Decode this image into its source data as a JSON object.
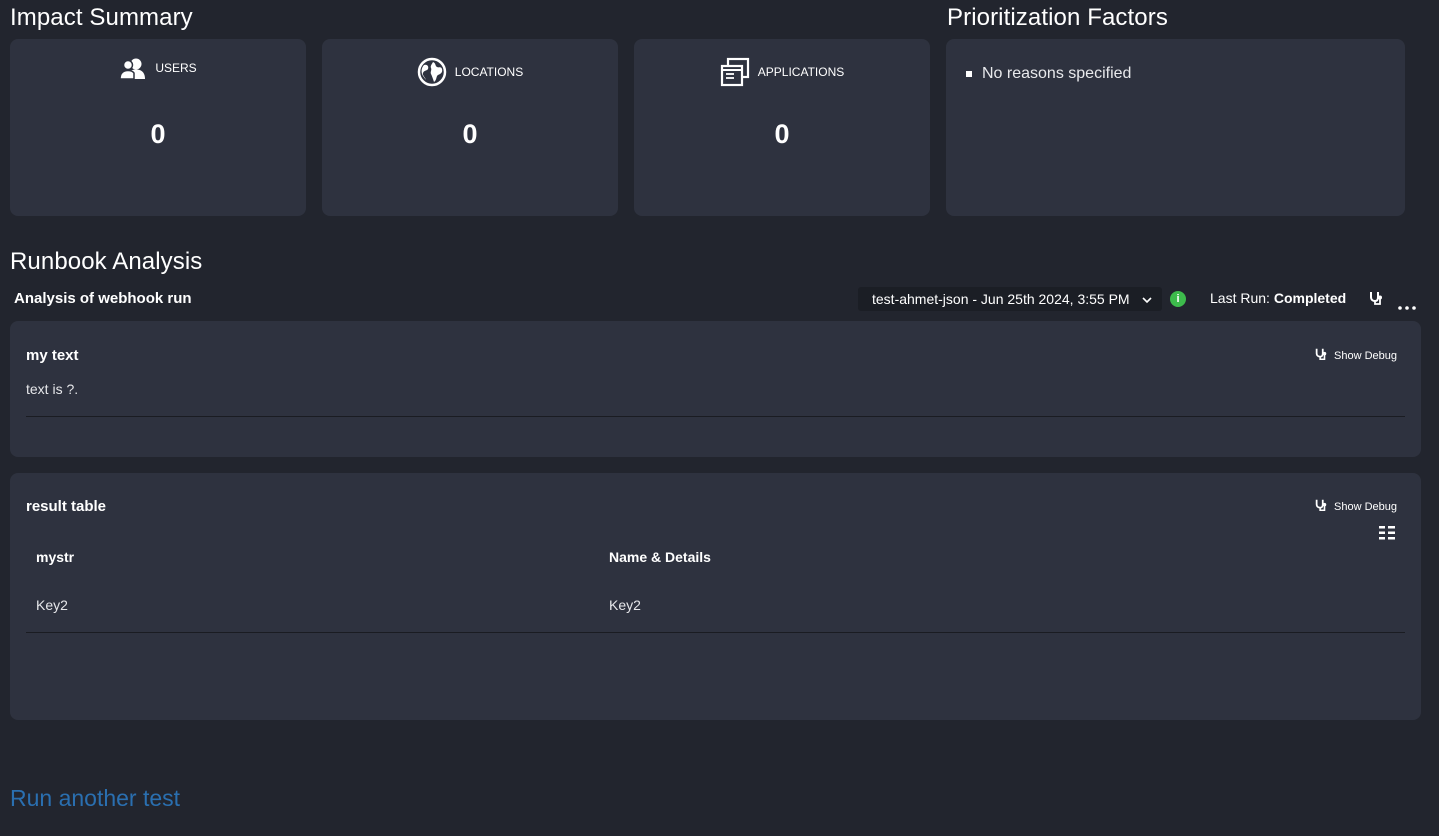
{
  "impact": {
    "title": "Impact Summary",
    "cards": [
      {
        "label": "USERS",
        "value": "0",
        "icon": "users-icon"
      },
      {
        "label": "LOCATIONS",
        "value": "0",
        "icon": "globe-icon"
      },
      {
        "label": "APPLICATIONS",
        "value": "0",
        "icon": "applications-icon"
      }
    ]
  },
  "prioritization": {
    "title": "Prioritization Factors",
    "items": [
      "No reasons specified"
    ]
  },
  "runbook": {
    "title": "Runbook Analysis",
    "subtitle": "Analysis of webhook run",
    "run_select": {
      "selected": "test-ahmet-json - Jun 25th 2024, 3:55 PM"
    },
    "last_run": {
      "label": "Last Run:",
      "status": "Completed"
    },
    "show_debug_label": "Show Debug",
    "text_card": {
      "title": "my text",
      "content": "text is ?."
    },
    "table_card": {
      "title": "result table",
      "columns": [
        "mystr",
        "Name & Details"
      ],
      "rows": [
        [
          "Key2",
          "Key2"
        ]
      ]
    }
  },
  "run_another_label": "Run another test",
  "colors": {
    "background": "#22252e",
    "card": "#2e323f",
    "link": "#2a6fb0",
    "status_green": "#3dbb4c"
  }
}
